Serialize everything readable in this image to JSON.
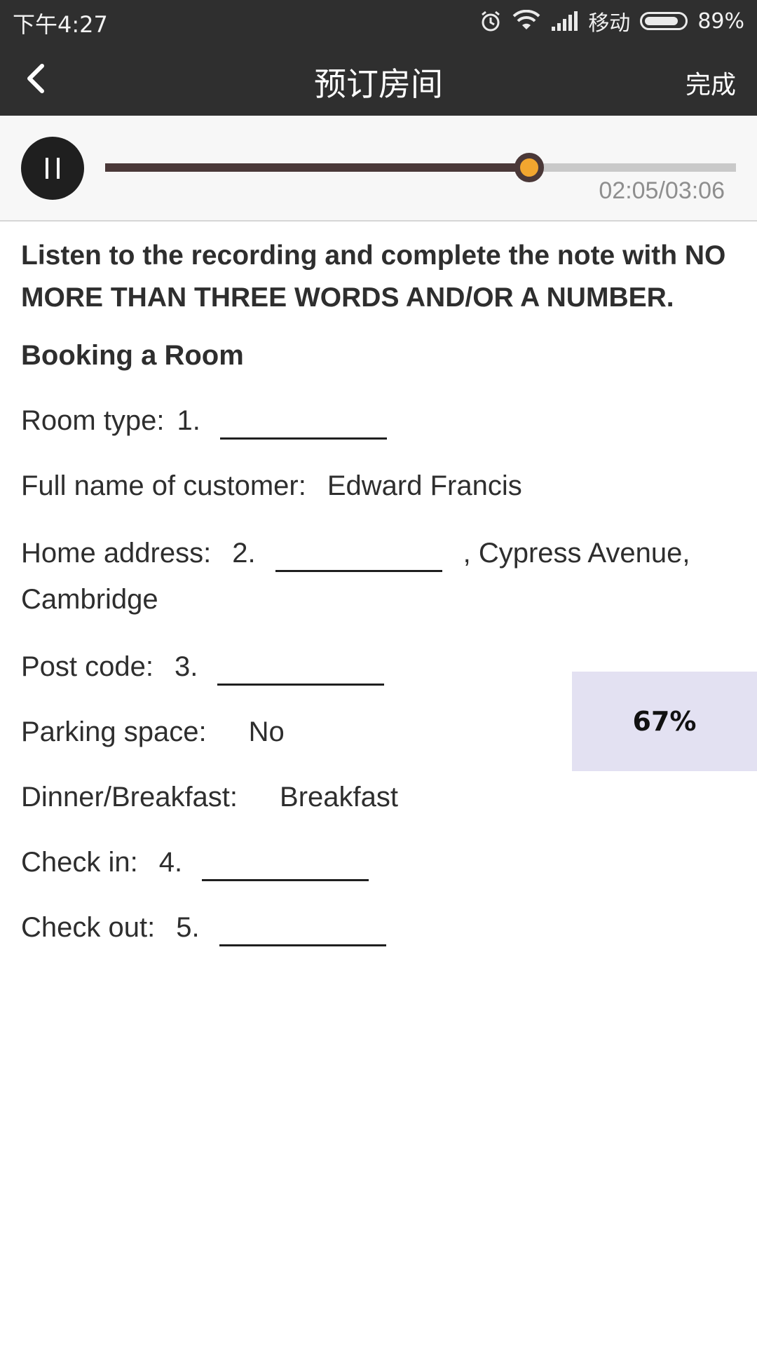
{
  "status_bar": {
    "time": "下午4:27",
    "carrier": "移动",
    "battery_percent": "89%",
    "battery_level": 0.89,
    "icons": [
      "alarm-icon",
      "wifi-icon",
      "signal-icon",
      "battery-icon"
    ]
  },
  "app_bar": {
    "title": "预订房间",
    "done_label": "完成",
    "back_icon": "chevron-left-icon"
  },
  "player": {
    "state": "playing",
    "pause_icon": "pause-icon",
    "time_readout": "02:05/03:06",
    "progress": 0.672,
    "colors": {
      "played": "#4a3838",
      "remaining": "#c9c9c9",
      "thumb": "#f2a62f"
    }
  },
  "content": {
    "instructions": "Listen to the recording and complete the note with NO MORE THAN THREE WORDS AND/OR A NUMBER.",
    "section_title": "Booking a Room",
    "rows": [
      {
        "label": "Room type:",
        "number": "1."
      },
      {
        "label": "Full name of customer:",
        "value": "Edward Francis"
      },
      {
        "label": "Home address:",
        "number": "2.",
        "suffix": ", Cypress Avenue,",
        "continuation": "Cambridge"
      },
      {
        "label": "Post code:",
        "number": "3."
      },
      {
        "label": "Parking space:",
        "value": "No"
      },
      {
        "label": "Dinner/Breakfast:",
        "value": "Breakfast"
      },
      {
        "label": "Check in:",
        "number": "4."
      },
      {
        "label": "Check out:",
        "number": "5."
      }
    ]
  },
  "overlay": {
    "percent_label": "67%",
    "color": "#e3e1f2"
  }
}
